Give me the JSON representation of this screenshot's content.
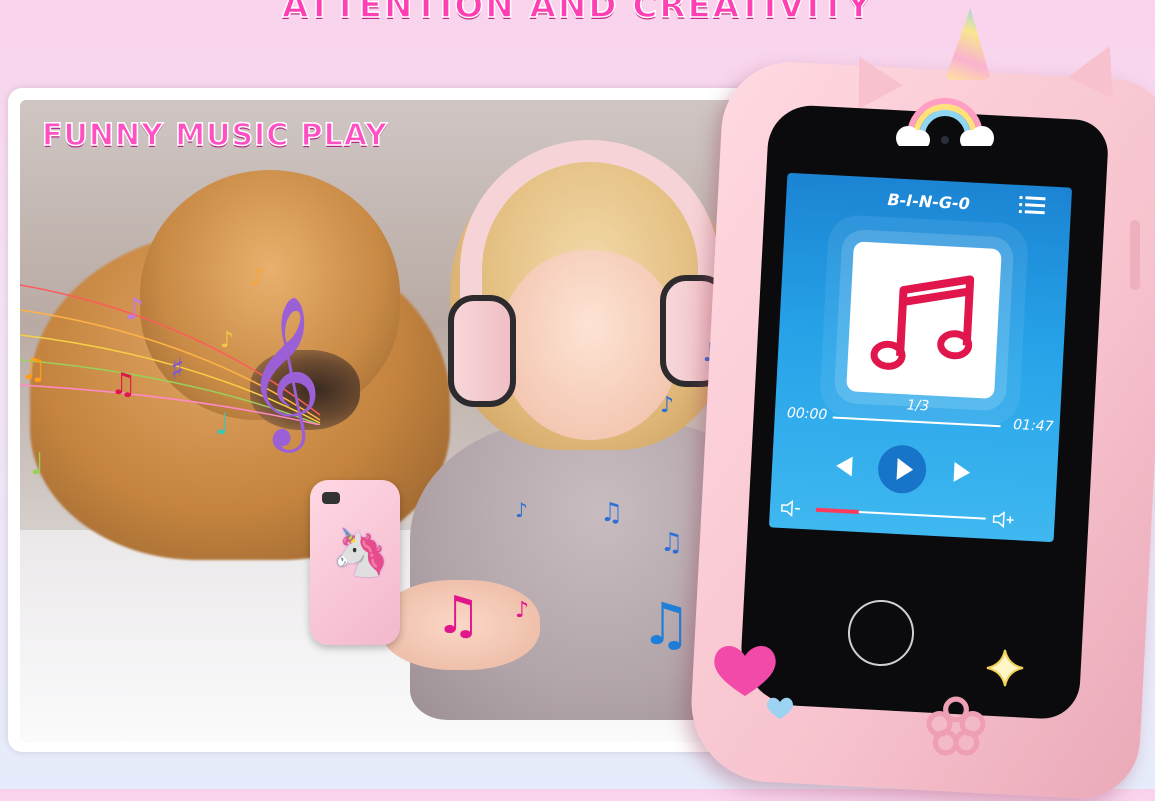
{
  "banner": {
    "headline": "ATTENTION AND CREATIVITY"
  },
  "photo": {
    "title": "FUNNY MUSIC PLAY"
  },
  "player": {
    "song_title": "B-I-N-G-0",
    "track_counter": "1/3",
    "time_elapsed": "00:00",
    "time_total": "01:47",
    "progress": 0.0,
    "volume": 0.25,
    "icons": [
      "playlist-menu-icon",
      "music-note-icon",
      "previous-icon",
      "play-icon",
      "next-icon",
      "volume-down-icon",
      "volume-up-icon"
    ]
  },
  "colors": {
    "accent_pink": "#ff3fb4",
    "screen_blue": "#1f95df",
    "phone_case": "#f7c3ce",
    "note_red": "#e0164c"
  }
}
